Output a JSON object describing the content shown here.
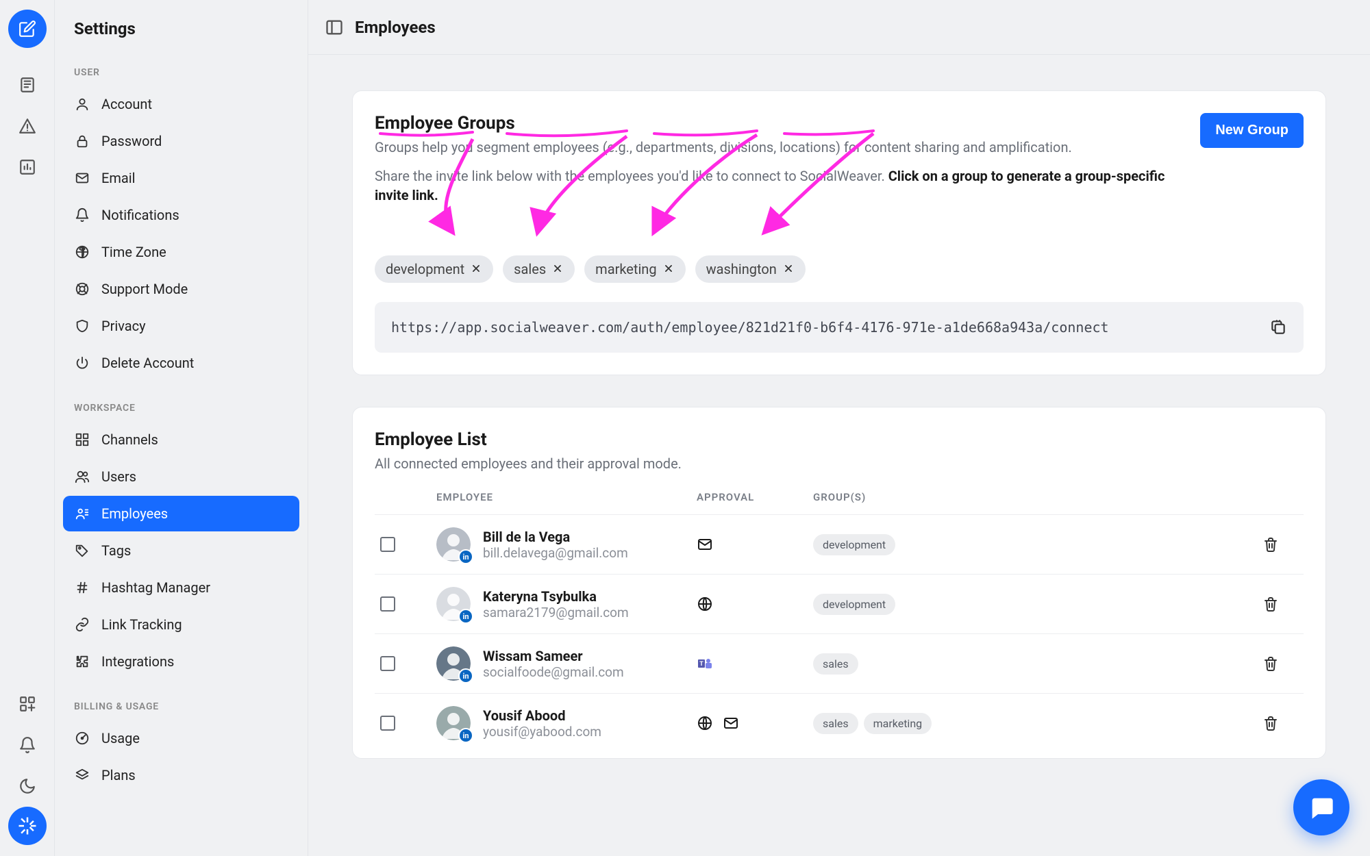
{
  "sidebar": {
    "title": "Settings",
    "sections": {
      "user": {
        "label": "USER",
        "items": [
          "Account",
          "Password",
          "Email",
          "Notifications",
          "Time Zone",
          "Support Mode",
          "Privacy",
          "Delete Account"
        ]
      },
      "workspace": {
        "label": "WORKSPACE",
        "items": [
          "Channels",
          "Users",
          "Employees",
          "Tags",
          "Hashtag Manager",
          "Link Tracking",
          "Integrations"
        ]
      },
      "billing": {
        "label": "BILLING & USAGE",
        "items": [
          "Usage",
          "Plans"
        ]
      }
    }
  },
  "header": {
    "title": "Employees"
  },
  "groups": {
    "title": "Employee Groups",
    "desc1": "Groups help you segment employees (e.g., departments, divisions, locations) for content sharing and amplification.",
    "desc2a": "Share the invite link below with the employees you'd like to connect to SocialWeaver. ",
    "desc2b": "Click on a group to generate a group-specific invite link.",
    "new_btn": "New Group",
    "chips": [
      "development",
      "sales",
      "marketing",
      "washington"
    ],
    "invite_url": "https://app.socialweaver.com/auth/employee/821d21f0-b6f4-4176-971e-a1de668a943a/connect"
  },
  "list": {
    "title": "Employee List",
    "subtitle": "All connected employees and their approval mode.",
    "cols": {
      "employee": "EMPLOYEE",
      "approval": "APPROVAL",
      "groups": "GROUP(S)"
    },
    "rows": [
      {
        "name": "Bill de la Vega",
        "email": "bill.delavega@gmail.com",
        "approval": [
          "mail"
        ],
        "groups": [
          "development"
        ]
      },
      {
        "name": "Kateryna Tsybulka",
        "email": "samara2179@gmail.com",
        "approval": [
          "web"
        ],
        "groups": [
          "development"
        ]
      },
      {
        "name": "Wissam Sameer",
        "email": "socialfoode@gmail.com",
        "approval": [
          "teams"
        ],
        "groups": [
          "sales"
        ]
      },
      {
        "name": "Yousif Abood",
        "email": "yousif@yabood.com",
        "approval": [
          "web",
          "mail"
        ],
        "groups": [
          "sales",
          "marketing"
        ]
      }
    ]
  },
  "colors": {
    "accent": "#176bff",
    "annotation": "#ff29e3"
  }
}
